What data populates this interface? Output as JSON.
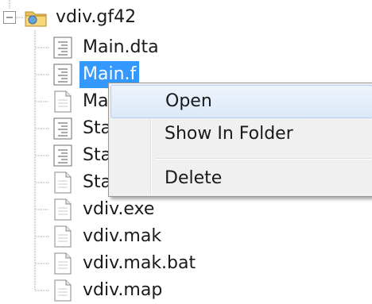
{
  "tree": {
    "root": {
      "label": "vdiv.gf42",
      "icon": "folder-icon",
      "expander": "minus"
    },
    "items": [
      {
        "label": "Main.dta",
        "icon": "module-file-icon",
        "selected": false
      },
      {
        "label": "Main.f",
        "icon": "module-file-icon",
        "selected": true
      },
      {
        "label": "Ma",
        "icon": "text-file-icon",
        "selected": false
      },
      {
        "label": "Sta",
        "icon": "module-file-icon",
        "selected": false
      },
      {
        "label": "Sta",
        "icon": "module-file-icon",
        "selected": false
      },
      {
        "label": "Sta",
        "icon": "text-file-icon",
        "selected": false
      },
      {
        "label": "vdiv.exe",
        "icon": "text-file-icon",
        "selected": false
      },
      {
        "label": "vdiv.mak",
        "icon": "text-file-icon",
        "selected": false
      },
      {
        "label": "vdiv.mak.bat",
        "icon": "text-file-icon",
        "selected": false
      },
      {
        "label": "vdiv.map",
        "icon": "text-file-icon",
        "selected": false
      }
    ]
  },
  "context_menu": {
    "items": [
      {
        "label": "Open",
        "hover": true
      },
      {
        "label": "Show In Folder",
        "hover": false
      },
      {
        "label": "Delete",
        "hover": false
      }
    ]
  },
  "colors": {
    "selection": "#3399ff",
    "menu_background": "#f0f0f0",
    "tree_lines": "#a0a0a0"
  }
}
